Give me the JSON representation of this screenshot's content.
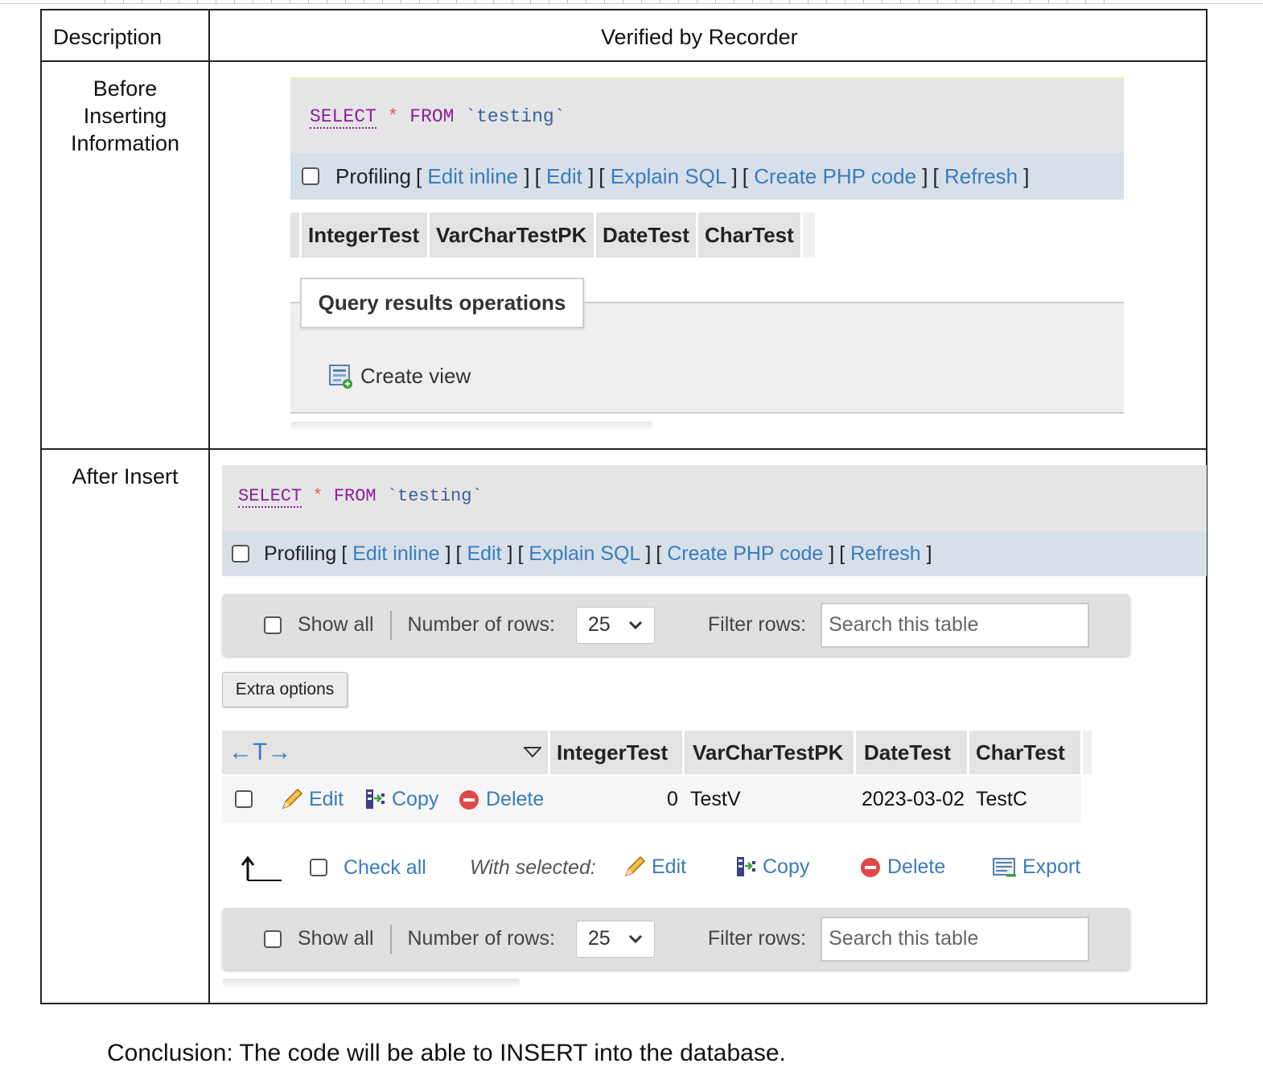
{
  "table": {
    "header_description": "Description",
    "header_verified": "Verified by Recorder",
    "row1_description_lines": [
      "Before",
      "Inserting",
      "Information"
    ],
    "row2_description": "After Insert"
  },
  "before": {
    "sql": {
      "select": "SELECT",
      "star": "*",
      "from": "FROM",
      "table": "`testing`"
    },
    "profiling": {
      "label": "Profiling",
      "links": [
        "Edit inline",
        "Edit",
        "Explain SQL",
        "Create PHP code",
        "Refresh"
      ]
    },
    "columns": [
      "IntegerTest",
      "VarCharTestPK",
      "DateTest",
      "CharTest"
    ],
    "operations_legend": "Query results operations",
    "create_view": "Create view"
  },
  "after": {
    "sql": {
      "select": "SELECT",
      "star": "*",
      "from": "FROM",
      "table": "`testing`"
    },
    "profiling": {
      "label": "Profiling",
      "links": [
        "Edit inline",
        "Edit",
        "Explain SQL",
        "Create PHP code",
        "Refresh"
      ]
    },
    "nav": {
      "show_all": "Show all",
      "number_of_rows_label": "Number of rows:",
      "number_of_rows_value": "25",
      "filter_rows_label": "Filter rows:",
      "search_placeholder": "Search this table"
    },
    "extra_options": "Extra options",
    "sort_arrows": "←T→",
    "columns": [
      "IntegerTest",
      "VarCharTestPK",
      "DateTest",
      "CharTest"
    ],
    "row_actions": {
      "edit": "Edit",
      "copy": "Copy",
      "delete": "Delete"
    },
    "data_row": {
      "IntegerTest": "0",
      "VarCharTestPK": "TestV",
      "DateTest": "2023-03-02",
      "CharTest": "TestC"
    },
    "bulk": {
      "check_all": "Check all",
      "with_selected": "With selected:",
      "edit": "Edit",
      "copy": "Copy",
      "delete": "Delete",
      "export": "Export"
    }
  },
  "conclusion": "Conclusion: The code will be able to INSERT into the database."
}
